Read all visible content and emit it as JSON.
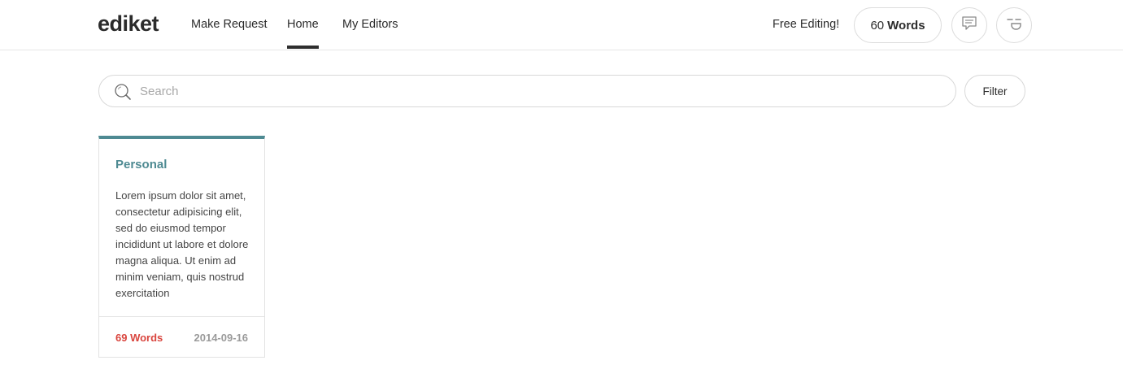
{
  "header": {
    "logo": "ediket",
    "nav": [
      {
        "label": "Make Request",
        "active": false
      },
      {
        "label": "Home",
        "active": true
      },
      {
        "label": "My Editors",
        "active": false
      }
    ],
    "free_editing": "Free Editing!",
    "words_count": "60",
    "words_unit": "Words",
    "icons": [
      "chat-icon",
      "user-face-icon"
    ]
  },
  "search": {
    "placeholder": "Search",
    "value": "",
    "filter_label": "Filter"
  },
  "cards": [
    {
      "title": "Personal",
      "body": "Lorem ipsum dolor sit amet, consectetur adipisicing elit, sed do eiusmod tempor incididunt ut labore et dolore magna aliqua. Ut enim ad minim veniam, quis nostrud exercitation",
      "words": "69 Words",
      "date": "2014-09-16"
    }
  ],
  "colors": {
    "accent": "#4e8a92",
    "words_red": "#d9453e",
    "date_gray": "#9a9a9a",
    "active_underline": "#2e2e2e"
  }
}
